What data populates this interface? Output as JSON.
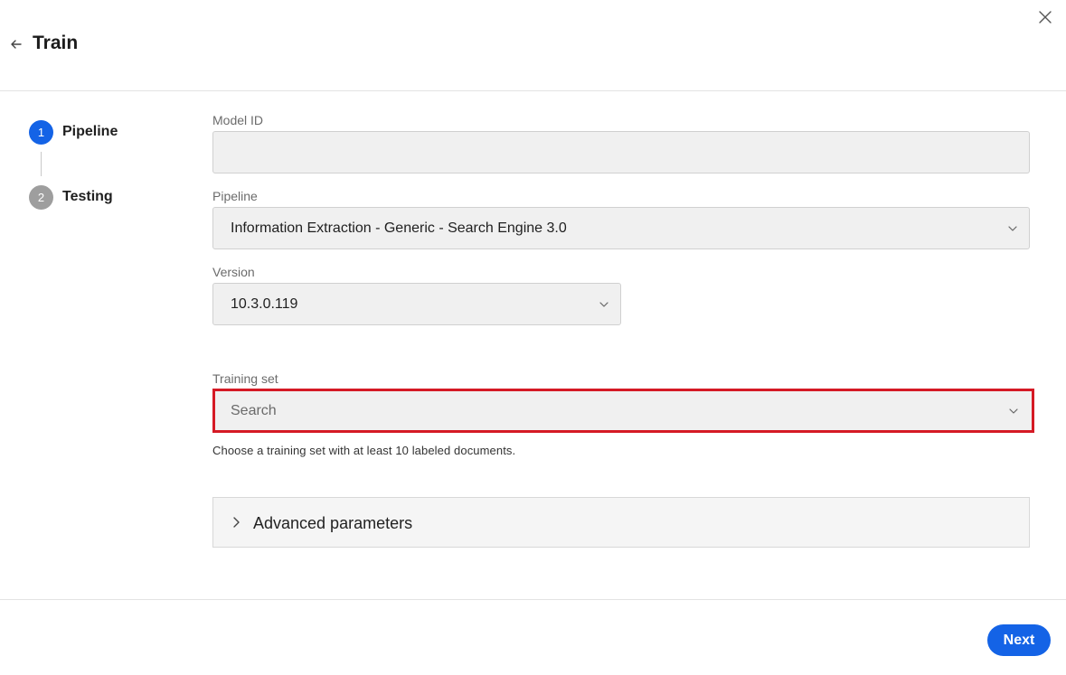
{
  "header": {
    "title": "Train"
  },
  "icons": {
    "back": "arrow-left-icon",
    "close": "close-icon",
    "dropdown": "chevron-down-icon",
    "expand": "chevron-right-icon"
  },
  "colors": {
    "accent": "#1463e6",
    "step_inactive": "#9e9e9e",
    "highlight_border": "#d51a25"
  },
  "stepper": {
    "steps": [
      {
        "number": "1",
        "label": "Pipeline",
        "state": "active"
      },
      {
        "number": "2",
        "label": "Testing",
        "state": "inactive"
      }
    ]
  },
  "form": {
    "model_id": {
      "label": "Model ID",
      "value": ""
    },
    "pipeline": {
      "label": "Pipeline",
      "value": "Information Extraction - Generic - Search Engine 3.0"
    },
    "version": {
      "label": "Version",
      "value": "10.3.0.119"
    },
    "training_set": {
      "label": "Training set",
      "placeholder": "Search",
      "helper": "Choose a training set with at least 10 labeled documents."
    },
    "advanced": {
      "label": "Advanced parameters"
    }
  },
  "footer": {
    "next_label": "Next"
  }
}
